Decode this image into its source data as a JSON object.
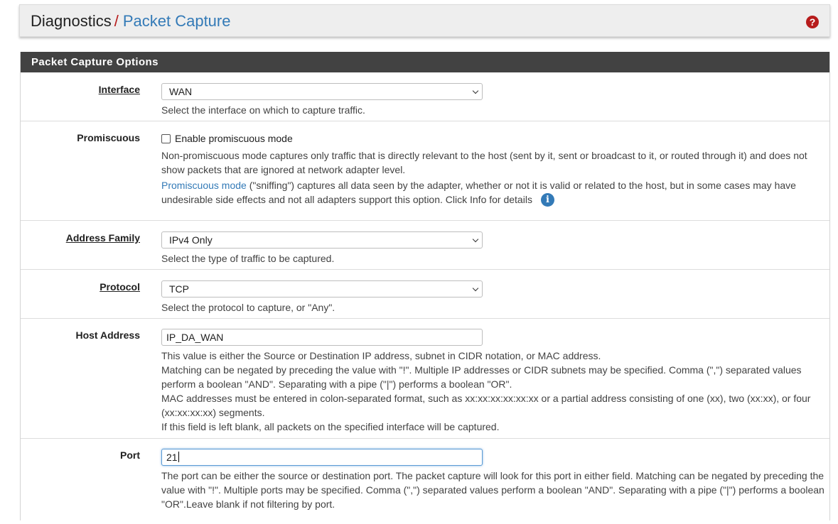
{
  "breadcrumb": {
    "root": "Diagnostics",
    "separator": "/",
    "page": "Packet Capture"
  },
  "panel": {
    "title": "Packet Capture Options"
  },
  "fields": {
    "interface": {
      "label": "Interface",
      "value": "WAN",
      "help": "Select the interface on which to capture traffic."
    },
    "promiscuous": {
      "label": "Promiscuous",
      "checkbox_label": "Enable promiscuous mode",
      "checked": false,
      "help1": "Non-promiscuous mode captures only traffic that is directly relevant to the host (sent by it, sent or broadcast to it, or routed through it) and does not show packets that are ignored at network adapter level.",
      "help2_link": "Promiscuous mode",
      "help2_text": " (\"sniffing\") captures all data seen by the adapter, whether or not it is valid or related to the host, but in some cases may have undesirable side effects and not all adapters support this option. Click Info for details"
    },
    "address_family": {
      "label": "Address Family",
      "value": "IPv4 Only",
      "help": "Select the type of traffic to be captured."
    },
    "protocol": {
      "label": "Protocol",
      "value": "TCP",
      "help": "Select the protocol to capture, or \"Any\"."
    },
    "host_address": {
      "label": "Host Address",
      "value": "IP_DA_WAN",
      "help1": "This value is either the Source or Destination IP address, subnet in CIDR notation, or MAC address.",
      "help2": "Matching can be negated by preceding the value with \"!\". Multiple IP addresses or CIDR subnets may be specified. Comma (\",\") separated values perform a boolean \"AND\". Separating with a pipe (\"|\") performs a boolean \"OR\".",
      "help3": "MAC addresses must be entered in colon-separated format, such as xx:xx:xx:xx:xx:xx or a partial address consisting of one (xx), two (xx:xx), or four (xx:xx:xx:xx) segments.",
      "help4": "If this field is left blank, all packets on the specified interface will be captured."
    },
    "port": {
      "label": "Port",
      "value": "21",
      "help": "The port can be either the source or destination port. The packet capture will look for this port in either field. Matching can be negated by preceding the value with \"!\". Multiple ports may be specified. Comma (\",\") separated values perform a boolean \"AND\". Separating with a pipe (\"|\") performs a boolean \"OR\".Leave blank if not filtering by port."
    }
  },
  "icons": {
    "help": "question-circle-icon",
    "info": "info-circle-icon",
    "chevron": "chevron-down-icon"
  },
  "colors": {
    "accent": "#337ab7",
    "separator": "#b71c1c",
    "panel_heading": "#424242"
  }
}
